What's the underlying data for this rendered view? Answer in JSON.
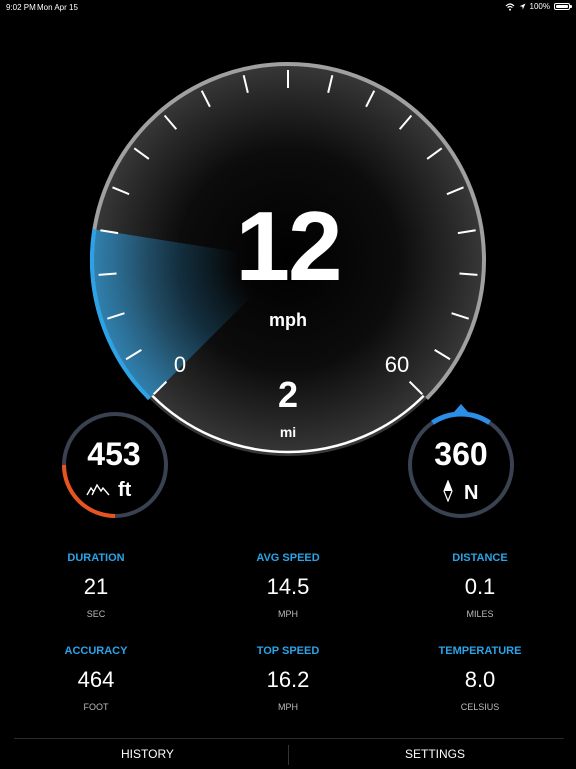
{
  "status_bar": {
    "time": "9:02 PM",
    "date": "Mon Apr 15",
    "battery": "100%"
  },
  "gauge": {
    "speed": "12",
    "speed_unit": "mph",
    "min_label": "0",
    "max_label": "60",
    "trip": "2",
    "trip_unit": "mi",
    "speed_fraction": 0.2,
    "accent_color": "#2ba3e8"
  },
  "altitude": {
    "value": "453",
    "unit": "ft",
    "icon": "mountain-icon",
    "fraction": 0.25,
    "ring_color": "#e8531f"
  },
  "heading": {
    "value": "360",
    "direction": "N",
    "icon": "compass-needle-icon",
    "ring_color": "#2b8fe8"
  },
  "stats": [
    {
      "label": "DURATION",
      "value": "21",
      "unit": "SEC"
    },
    {
      "label": "AVG SPEED",
      "value": "14.5",
      "unit": "MPH"
    },
    {
      "label": "DISTANCE",
      "value": "0.1",
      "unit": "MILES"
    },
    {
      "label": "ACCURACY",
      "value": "464",
      "unit": "FOOT"
    },
    {
      "label": "TOP SPEED",
      "value": "16.2",
      "unit": "MPH"
    },
    {
      "label": "TEMPERATURE",
      "value": "8.0",
      "unit": "CELSIUS"
    }
  ],
  "bottom_bar": {
    "history": "HISTORY",
    "settings": "SETTINGS"
  }
}
